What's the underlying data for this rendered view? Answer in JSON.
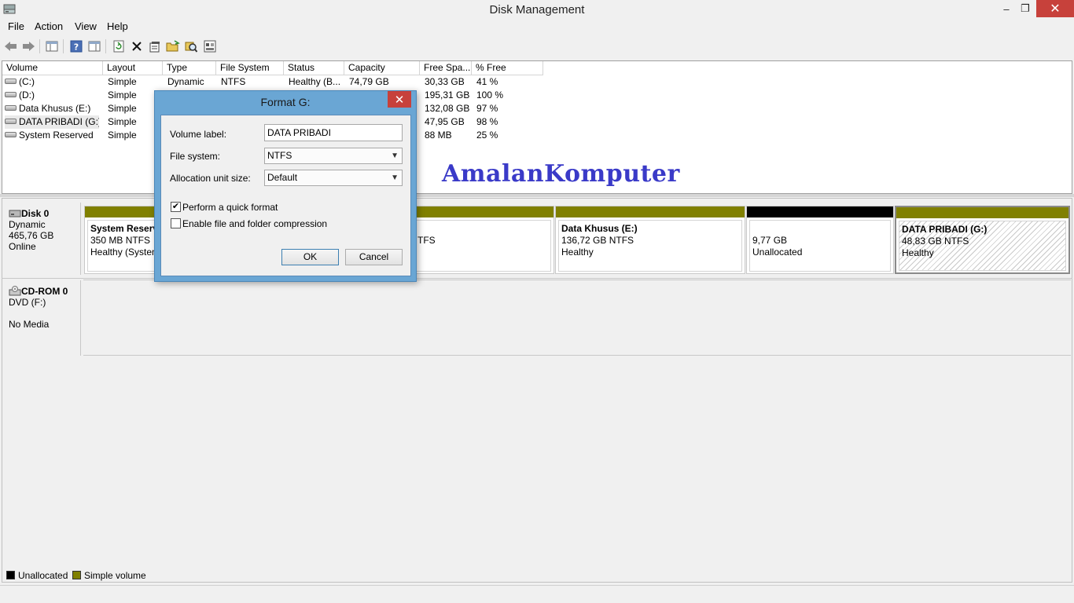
{
  "window": {
    "title": "Disk Management",
    "minimize_glyph": "–",
    "maximize_glyph": "❐",
    "close_glyph": "✕"
  },
  "menu": [
    "File",
    "Action",
    "View",
    "Help"
  ],
  "toolbar": {
    "icons": [
      "back-arrow-icon",
      "forward-arrow-icon",
      "console-tree-icon",
      "help-icon",
      "show-hide-action-pane-icon",
      "refresh-icon",
      "delete-icon",
      "properties-icon",
      "open-icon",
      "explore-icon",
      "disk-settings-icon"
    ]
  },
  "volume_list": {
    "columns": [
      "Volume",
      "Layout",
      "Type",
      "File System",
      "Status",
      "Capacity",
      "Free Spa...",
      "% Free"
    ],
    "rows": [
      {
        "volume": "(C:)",
        "layout": "Simple",
        "type": "Dynamic",
        "fs": "NTFS",
        "status": "Healthy (B...",
        "capacity": "74,79 GB",
        "free": "30,33 GB",
        "pct": "41 %"
      },
      {
        "volume": "(D:)",
        "layout": "Simple",
        "type": "",
        "fs": "",
        "status": "",
        "capacity": "",
        "free": "195,31 GB",
        "pct": "100 %"
      },
      {
        "volume": "Data Khusus (E:)",
        "layout": "Simple",
        "type": "",
        "fs": "",
        "status": "",
        "capacity": "",
        "free": "132,08 GB",
        "pct": "97 %"
      },
      {
        "volume": "DATA PRIBADI (G:)",
        "layout": "Simple",
        "type": "",
        "fs": "",
        "status": "",
        "capacity": "",
        "free": "47,95 GB",
        "pct": "98 %"
      },
      {
        "volume": "System Reserved",
        "layout": "Simple",
        "type": "",
        "fs": "",
        "status": "",
        "capacity": "",
        "free": "88 MB",
        "pct": "25 %"
      }
    ]
  },
  "watermark": "AmalanKomputer",
  "disk0": {
    "name": "Disk 0",
    "type": "Dynamic",
    "size": "465,76 GB",
    "state": "Online",
    "partitions": [
      {
        "name": "System Reserv",
        "size": "350 MB NTFS",
        "status": "Healthy (System",
        "kind": "simple"
      },
      {
        "name": "",
        "size": "TFS",
        "status": "",
        "kind": "simple"
      },
      {
        "name": "Data Khusus  (E:)",
        "size": "136,72 GB NTFS",
        "status": "Healthy",
        "kind": "simple"
      },
      {
        "name": "",
        "size": "9,77 GB",
        "status": "Unallocated",
        "kind": "unallocated"
      },
      {
        "name": "DATA PRIBADI  (G:)",
        "size": "48,83 GB NTFS",
        "status": "Healthy",
        "kind": "simple-selected"
      }
    ]
  },
  "cdrom0": {
    "name": "CD-ROM 0",
    "type": "DVD (F:)",
    "state": "No Media"
  },
  "legend": [
    {
      "label": "Unallocated",
      "color": "#000000"
    },
    {
      "label": "Simple volume",
      "color": "#808000"
    }
  ],
  "colors": {
    "simple_volume": "#808000",
    "unallocated": "#000000",
    "dialog_frame": "#6aa6d4",
    "close_red": "#c7413b"
  },
  "dialog": {
    "title": "Format G:",
    "close_glyph": "✕",
    "volume_label_caption": "Volume label:",
    "volume_label_value": "DATA PRIBADI",
    "file_system_caption": "File system:",
    "file_system_value": "NTFS",
    "alloc_caption": "Allocation unit size:",
    "alloc_value": "Default",
    "quick_format_label": "Perform a quick format",
    "quick_format_checked": true,
    "compression_label": "Enable file and folder compression",
    "compression_checked": false,
    "ok_label": "OK",
    "cancel_label": "Cancel"
  }
}
